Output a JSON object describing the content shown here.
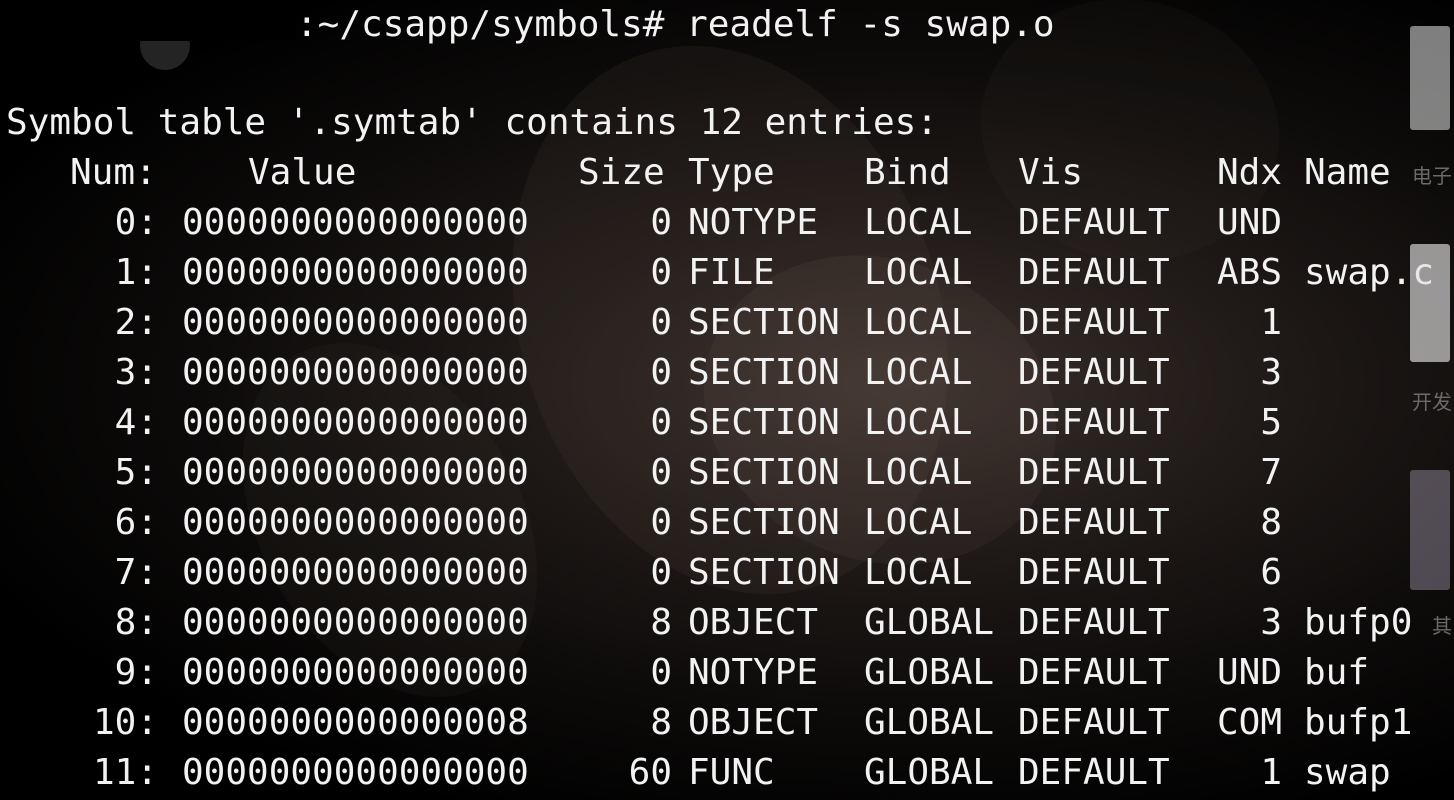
{
  "prompt": {
    "text": ":~/csapp/symbols# readelf -s swap.o"
  },
  "symtab": {
    "heading": "Symbol table '.symtab' contains 12 entries:",
    "headers": {
      "num": "Num:",
      "value": "Value",
      "size": "Size",
      "type": "Type",
      "bind": "Bind",
      "vis": "Vis",
      "ndx": "Ndx",
      "name": "Name"
    },
    "rows": [
      {
        "num": "0:",
        "value": "0000000000000000",
        "size": "0",
        "type": "NOTYPE",
        "bind": "LOCAL",
        "vis": "DEFAULT",
        "ndx": "UND",
        "name": ""
      },
      {
        "num": "1:",
        "value": "0000000000000000",
        "size": "0",
        "type": "FILE",
        "bind": "LOCAL",
        "vis": "DEFAULT",
        "ndx": "ABS",
        "name": "swap.c"
      },
      {
        "num": "2:",
        "value": "0000000000000000",
        "size": "0",
        "type": "SECTION",
        "bind": "LOCAL",
        "vis": "DEFAULT",
        "ndx": "1",
        "name": ""
      },
      {
        "num": "3:",
        "value": "0000000000000000",
        "size": "0",
        "type": "SECTION",
        "bind": "LOCAL",
        "vis": "DEFAULT",
        "ndx": "3",
        "name": ""
      },
      {
        "num": "4:",
        "value": "0000000000000000",
        "size": "0",
        "type": "SECTION",
        "bind": "LOCAL",
        "vis": "DEFAULT",
        "ndx": "5",
        "name": ""
      },
      {
        "num": "5:",
        "value": "0000000000000000",
        "size": "0",
        "type": "SECTION",
        "bind": "LOCAL",
        "vis": "DEFAULT",
        "ndx": "7",
        "name": ""
      },
      {
        "num": "6:",
        "value": "0000000000000000",
        "size": "0",
        "type": "SECTION",
        "bind": "LOCAL",
        "vis": "DEFAULT",
        "ndx": "8",
        "name": ""
      },
      {
        "num": "7:",
        "value": "0000000000000000",
        "size": "0",
        "type": "SECTION",
        "bind": "LOCAL",
        "vis": "DEFAULT",
        "ndx": "6",
        "name": ""
      },
      {
        "num": "8:",
        "value": "0000000000000000",
        "size": "8",
        "type": "OBJECT",
        "bind": "GLOBAL",
        "vis": "DEFAULT",
        "ndx": "3",
        "name": "bufp0"
      },
      {
        "num": "9:",
        "value": "0000000000000000",
        "size": "0",
        "type": "NOTYPE",
        "bind": "GLOBAL",
        "vis": "DEFAULT",
        "ndx": "UND",
        "name": "buf"
      },
      {
        "num": "10:",
        "value": "0000000000000008",
        "size": "8",
        "type": "OBJECT",
        "bind": "GLOBAL",
        "vis": "DEFAULT",
        "ndx": "COM",
        "name": "bufp1"
      },
      {
        "num": "11:",
        "value": "0000000000000000",
        "size": "60",
        "type": "FUNC",
        "bind": "GLOBAL",
        "vis": "DEFAULT",
        "ndx": "1",
        "name": "swap"
      }
    ]
  },
  "side_panel": {
    "labels": [
      "电子",
      "开发",
      "其"
    ]
  }
}
